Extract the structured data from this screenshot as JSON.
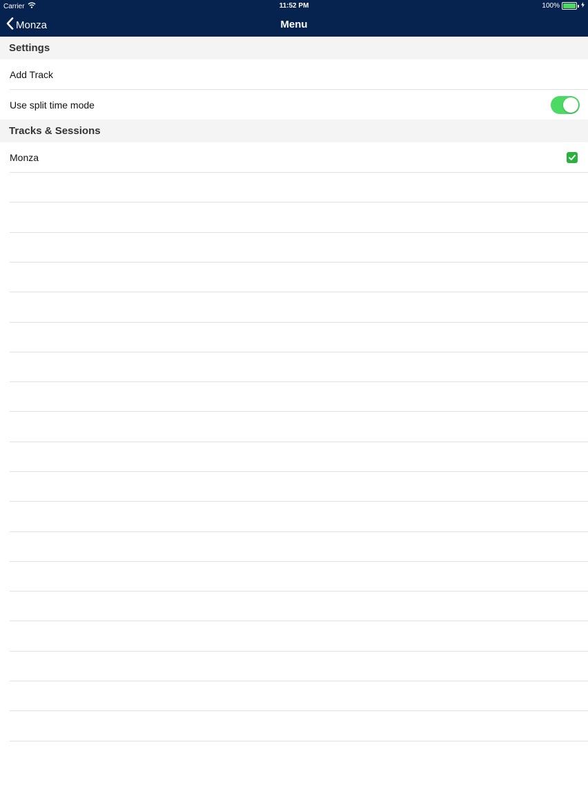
{
  "status_bar": {
    "carrier": "Carrier",
    "time": "11:52 PM",
    "battery": "100%",
    "battery_color": "#4cd964"
  },
  "nav": {
    "back_label": "Monza",
    "title": "Menu",
    "bar_color": "#06224f"
  },
  "sections": {
    "settings": {
      "header": "Settings",
      "add_track": "Add Track",
      "split_mode": {
        "label": "Use split time mode",
        "enabled": true
      }
    },
    "tracks": {
      "header": "Tracks & Sessions",
      "items": [
        {
          "label": "Monza",
          "checked": true
        }
      ]
    }
  },
  "colors": {
    "toggle_on": "#4cd964",
    "check": "#29b33e"
  },
  "icons": [
    "wifi-icon",
    "battery-icon",
    "charging-bolt-icon",
    "chevron-left-icon",
    "checkmark-icon"
  ]
}
